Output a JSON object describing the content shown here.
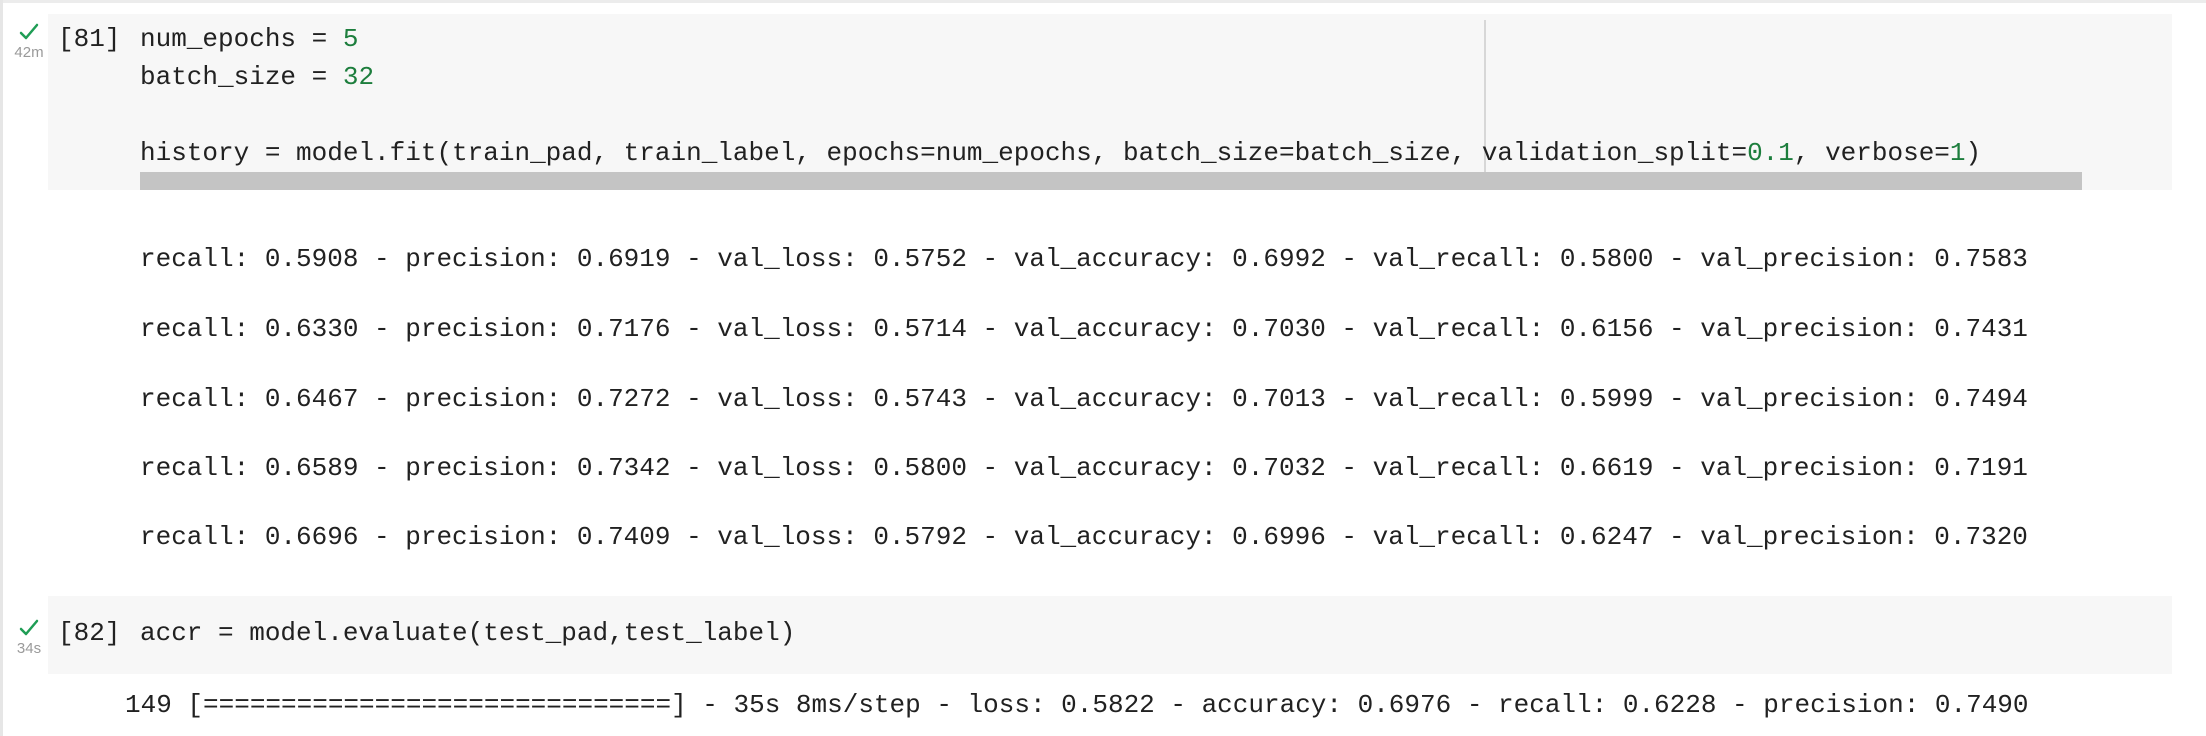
{
  "cells": [
    {
      "execution_count": "[81]",
      "exec_time": "42m",
      "status_icon": "check-icon",
      "code_lines": [
        [
          {
            "t": "num_epochs = ",
            "c": "plain"
          },
          {
            "t": "5",
            "c": "num"
          }
        ],
        [
          {
            "t": "batch_size = ",
            "c": "plain"
          },
          {
            "t": "32",
            "c": "num"
          }
        ],
        [],
        [
          {
            "t": "history = model.fit(train_pad, train_label, epochs=num_epochs, batch_size=batch_size, validation_split=",
            "c": "plain"
          },
          {
            "t": "0.1",
            "c": "num"
          },
          {
            "t": ", verbose=",
            "c": "plain"
          },
          {
            "t": "1",
            "c": "num"
          },
          {
            "t": ")",
            "c": "plain"
          }
        ]
      ],
      "output_lines": [
        "recall: 0.5908 - precision: 0.6919 - val_loss: 0.5752 - val_accuracy: 0.6992 - val_recall: 0.5800 - val_precision: 0.7583",
        "recall: 0.6330 - precision: 0.7176 - val_loss: 0.5714 - val_accuracy: 0.7030 - val_recall: 0.6156 - val_precision: 0.7431",
        "recall: 0.6467 - precision: 0.7272 - val_loss: 0.5743 - val_accuracy: 0.7013 - val_recall: 0.5999 - val_precision: 0.7494",
        "recall: 0.6589 - precision: 0.7342 - val_loss: 0.5800 - val_accuracy: 0.7032 - val_recall: 0.6619 - val_precision: 0.7191",
        "recall: 0.6696 - precision: 0.7409 - val_loss: 0.5792 - val_accuracy: 0.6996 - val_recall: 0.6247 - val_precision: 0.7320"
      ]
    },
    {
      "execution_count": "[82]",
      "exec_time": "34s",
      "status_icon": "check-icon",
      "code_line": "accr = model.evaluate(test_pad,test_label)",
      "output_line": "149 [==============================] - 35s 8ms/step - loss: 0.5822 - accuracy: 0.6976 - recall: 0.6228 - precision: 0.7490"
    }
  ],
  "colors": {
    "success_check": "#1f9d55",
    "number_literal": "#1d7e3d",
    "code_background": "#f7f7f7",
    "scrollbar": "#c4c4c4"
  }
}
